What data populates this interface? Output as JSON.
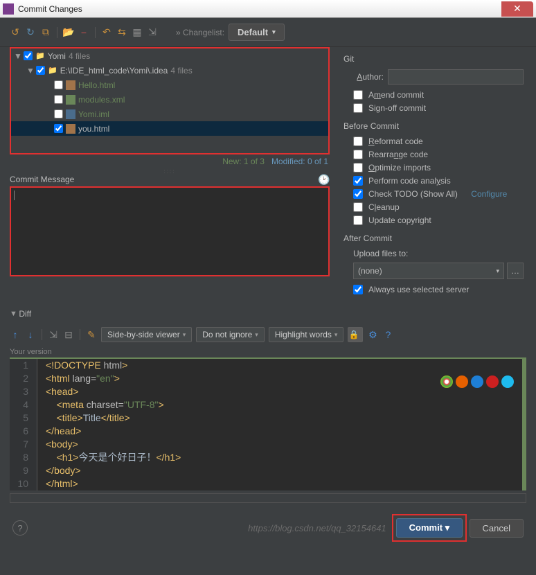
{
  "window": {
    "title": "Commit Changes"
  },
  "toolbar": {
    "changelist_label": "» Changelist:",
    "changelist_value": "Default"
  },
  "tree": {
    "root": {
      "name": "Yomi",
      "info": "4 files"
    },
    "subroot": {
      "name": "E:\\IDE_html_code\\Yomi\\.idea",
      "info": "4 files"
    },
    "files": [
      {
        "name": "Hello.html",
        "checked": false,
        "cls": "filename-green"
      },
      {
        "name": "modules.xml",
        "checked": false,
        "cls": "filename-green"
      },
      {
        "name": "Yomi.iml",
        "checked": false,
        "cls": "filename-green"
      },
      {
        "name": "you.html",
        "checked": true,
        "cls": "filename-highlight",
        "selected": true
      }
    ]
  },
  "status": {
    "new_text": "New: 1 of 3",
    "mod_text": "Modified: 0 of 1"
  },
  "commit_msg": {
    "header": "Commit Message"
  },
  "git": {
    "section": "Git",
    "author_label": "Author:",
    "author_value": "",
    "amend": "Amend commit",
    "signoff": "Sign-off commit"
  },
  "before": {
    "section": "Before Commit",
    "reformat": "Reformat code",
    "rearrange": "Rearrange code",
    "optimize": "Optimize imports",
    "analysis": "Perform code analysis",
    "todo": "Check TODO (Show All)",
    "configure": "Configure",
    "cleanup": "Cleanup",
    "copyright": "Update copyright"
  },
  "after": {
    "section": "After Commit",
    "upload_label": "Upload files to:",
    "upload_value": "(none)",
    "always": "Always use selected server"
  },
  "diff": {
    "header": "Diff",
    "view_mode": "Side-by-side viewer",
    "ignore": "Do not ignore",
    "highlight": "Highlight words",
    "your_version": "Your version"
  },
  "code": {
    "lines": [
      "<!DOCTYPE html>",
      "<html lang=\"en\">",
      "<head>",
      "    <meta charset=\"UTF-8\">",
      "    <title>Title</title>",
      "</head>",
      "<body>",
      "    <h1>今天是个好日子！</h1>",
      "</body>",
      "</html>"
    ]
  },
  "footer": {
    "watermark": "https://blog.csdn.net/qq_32154641",
    "commit": "Commit",
    "cancel": "Cancel"
  }
}
